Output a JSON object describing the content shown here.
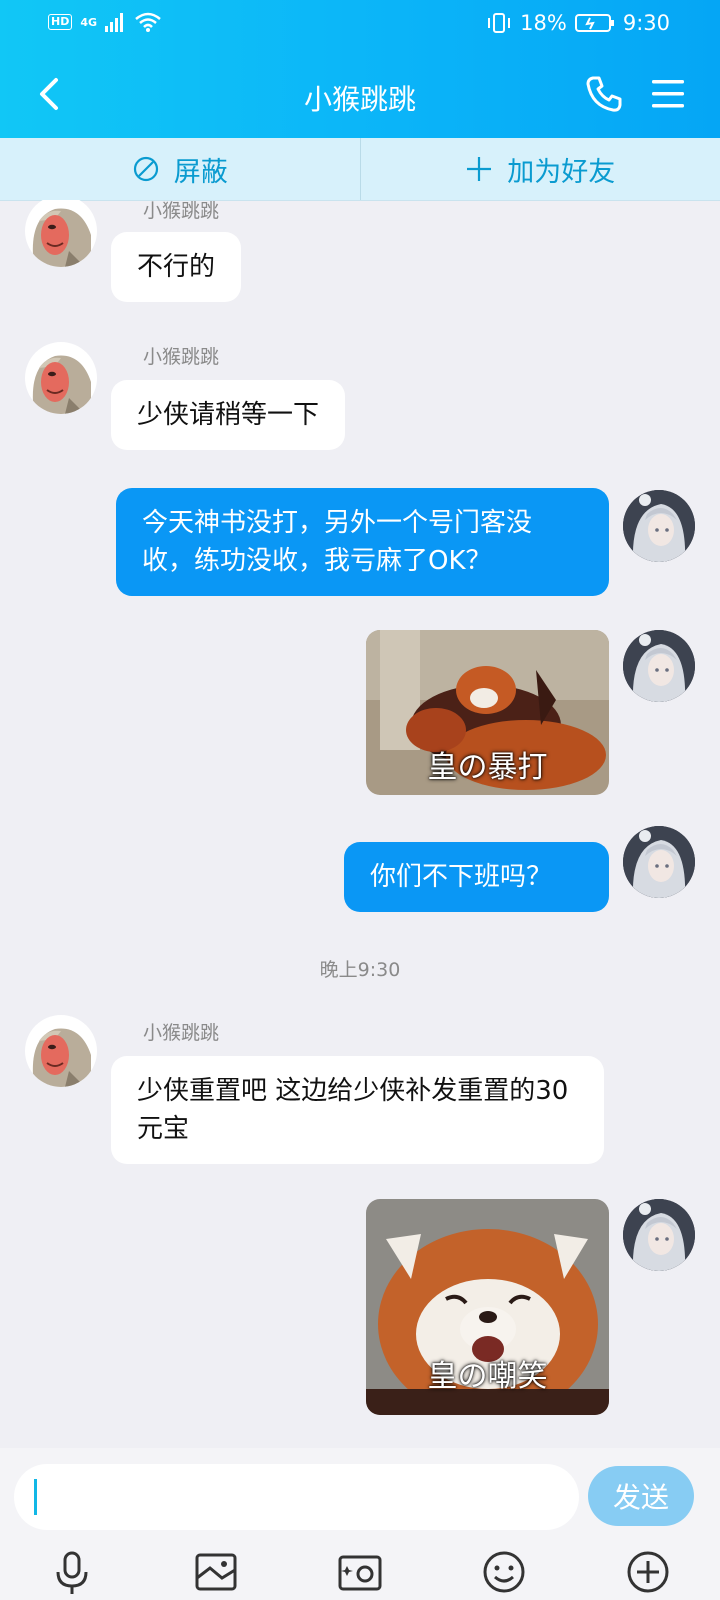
{
  "status": {
    "network": "4G",
    "battery": "18%",
    "time": "9:30",
    "hd": "HD"
  },
  "header": {
    "title": "小猴跳跳"
  },
  "actions": {
    "block": "屏蔽",
    "add_friend": "加为好友"
  },
  "messages": {
    "m1": {
      "sender": "小猴跳跳",
      "text": "不行的"
    },
    "m2": {
      "sender": "小猴跳跳",
      "text": "少侠请稍等一下"
    },
    "m3": {
      "text": "今天神书没打，另外一个号门客没收，练功没收，我亏麻了OK？"
    },
    "m4": {
      "caption": "皇の暴打"
    },
    "m5": {
      "text": "你们不下班吗？"
    },
    "timestamp": "晚上9:30",
    "m6": {
      "sender": "小猴跳跳",
      "text": "少侠重置吧 这边给少侠补发重置的30元宝"
    },
    "m7": {
      "caption": "皇の嘲笑"
    }
  },
  "input": {
    "send": "发送"
  },
  "toolbar_icons": [
    "microphone-icon",
    "image-icon",
    "camera-icon",
    "emoji-icon",
    "plus-icon"
  ],
  "colors": {
    "header": "#0bb4f8",
    "outgoing_bubble": "#0a97f5",
    "send_button": "#87ccf3",
    "action_text": "#0a9bd0"
  }
}
